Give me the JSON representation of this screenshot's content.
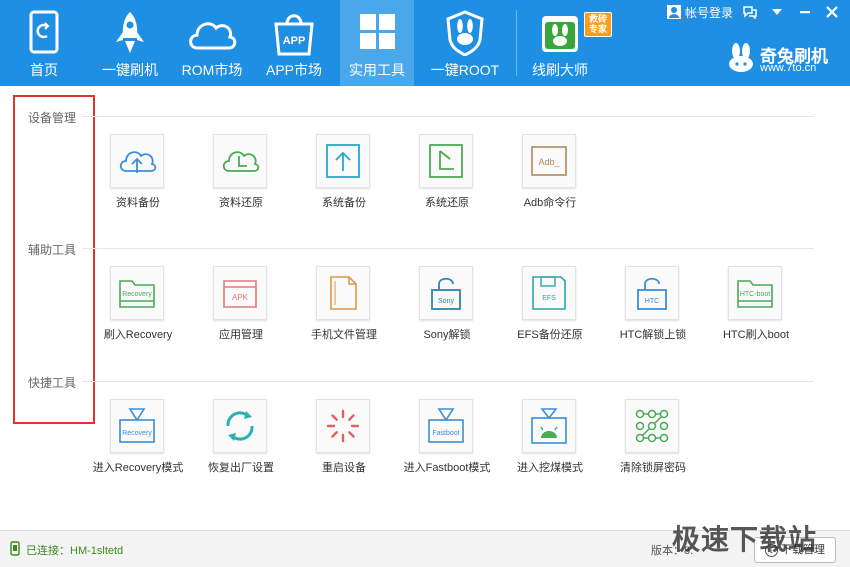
{
  "nav": {
    "items": [
      {
        "label": "首页",
        "icon": "phone-icon"
      },
      {
        "label": "一键刷机",
        "icon": "rocket-icon"
      },
      {
        "label": "ROM市场",
        "icon": "cloud-icon"
      },
      {
        "label": "APP市场",
        "icon": "shopping-bag-icon"
      },
      {
        "label": "实用工具",
        "icon": "grid-icon",
        "active": true
      },
      {
        "label": "一键ROOT",
        "icon": "shield-rabbit-icon"
      },
      {
        "label": "线刷大师",
        "icon": "rabbit-master-icon"
      }
    ],
    "badge": "救砖专家"
  },
  "window": {
    "login": "帐号登录",
    "brand_name": "奇兔刷机",
    "brand_url": "www.7to.cn"
  },
  "sections": {
    "device": {
      "title": "设备管理",
      "tools": [
        {
          "label": "资料备份",
          "icon": "cloud-upload-icon"
        },
        {
          "label": "资料还原",
          "icon": "cloud-restore-icon"
        },
        {
          "label": "系统备份",
          "icon": "upload-box-icon"
        },
        {
          "label": "系统还原",
          "icon": "restore-box-icon"
        },
        {
          "label": "Adb命令行",
          "icon": "terminal-icon",
          "text": "Adb_"
        }
      ]
    },
    "assist": {
      "title": "辅助工具",
      "tools": [
        {
          "label": "刷入Recovery",
          "icon": "folder-icon",
          "text": "Recovery"
        },
        {
          "label": "应用管理",
          "icon": "apk-box-icon",
          "text": "APK"
        },
        {
          "label": "手机文件管理",
          "icon": "file-icon"
        },
        {
          "label": "Sony解锁",
          "icon": "lock-icon",
          "text": "Sony"
        },
        {
          "label": "EFS备份还原",
          "icon": "floppy-icon",
          "text": "EFS"
        },
        {
          "label": "HTC解锁上锁",
          "icon": "lock-icon",
          "text": "HTC"
        },
        {
          "label": "HTC刷入boot",
          "icon": "folder-icon",
          "text": "HTC-boot"
        }
      ]
    },
    "quick": {
      "title": "快捷工具",
      "tools": [
        {
          "label": "进入Recovery模式",
          "icon": "down-arrow-box-icon",
          "text": "Recovery"
        },
        {
          "label": "恢复出厂设置",
          "icon": "refresh-icon"
        },
        {
          "label": "重启设备",
          "icon": "loading-icon"
        },
        {
          "label": "进入Fastboot模式",
          "icon": "down-arrow-box-icon",
          "text": "Fastboot"
        },
        {
          "label": "进入挖煤模式",
          "icon": "android-icon"
        },
        {
          "label": "清除锁屏密码",
          "icon": "pattern-lock-icon"
        }
      ]
    }
  },
  "status": {
    "connected": "已连接：HM-1sltetd",
    "version": "版本：8.",
    "download": "下载管理"
  },
  "watermark": "极速下载站",
  "colors": {
    "topbar": "#1f8fe4",
    "active_tab": "#4aa8ea",
    "highlight": "#e0352b",
    "status_green": "#3a8a1c"
  }
}
